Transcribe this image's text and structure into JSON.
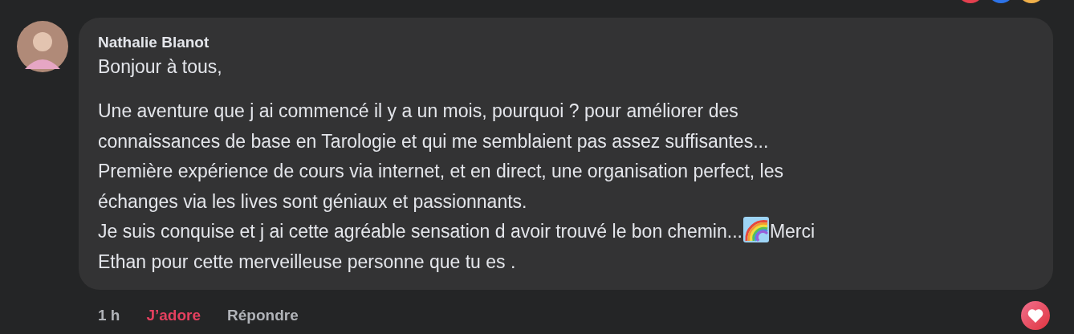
{
  "reactions_above": [
    {
      "color": "#e4404f"
    },
    {
      "color": "#2d73e8"
    },
    {
      "color": "#f0b04a"
    }
  ],
  "comment": {
    "author": "Nathalie Blanot",
    "greeting": "Bonjour à tous,",
    "lines": [
      [
        {
          "kind": "text",
          "text": "Une aventure que j ai commencé il y a un mois, pourquoi ? pour améliorer des"
        }
      ],
      [
        {
          "kind": "text",
          "text": "connaissances de base en Tarologie et qui me semblaient pas assez suffisantes..."
        }
      ],
      [
        {
          "kind": "text",
          "text": "Première expérience de cours via internet, et en direct, une organisation perfect, les"
        }
      ],
      [
        {
          "kind": "text",
          "text": "échanges via les lives sont géniaux et passionnants."
        }
      ],
      [
        {
          "kind": "text",
          "text": "Je suis conquise et j ai cette agréable sensation d avoir trouvé le bon chemin..."
        },
        {
          "kind": "rainbow"
        },
        {
          "kind": "text",
          "text": "Merci"
        }
      ],
      [
        {
          "kind": "text",
          "text": "Ethan pour cette merveilleuse personne que tu es ."
        }
      ]
    ],
    "time": "1 h",
    "like": {
      "label": "J’adore",
      "selected": true
    },
    "reply": "Répondre",
    "reaction": {
      "kind": "love"
    }
  }
}
